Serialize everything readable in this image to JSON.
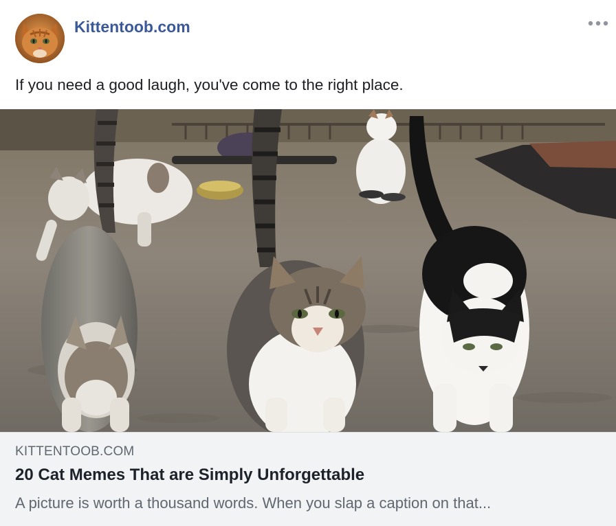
{
  "post": {
    "page_name": "Kittentoob.com",
    "more_icon": "more-horizontal-icon",
    "caption": "If you need a good laugh, you've come to the right place."
  },
  "link_preview": {
    "domain": "KITTENTOOB.COM",
    "title": "20 Cat Memes That are Simply Unforgettable",
    "description": "A picture is worth a thousand words. When you slap a caption on that..."
  },
  "colors": {
    "page_name": "#3b5998",
    "card_background": "#f2f3f5",
    "muted_text": "#606770"
  }
}
